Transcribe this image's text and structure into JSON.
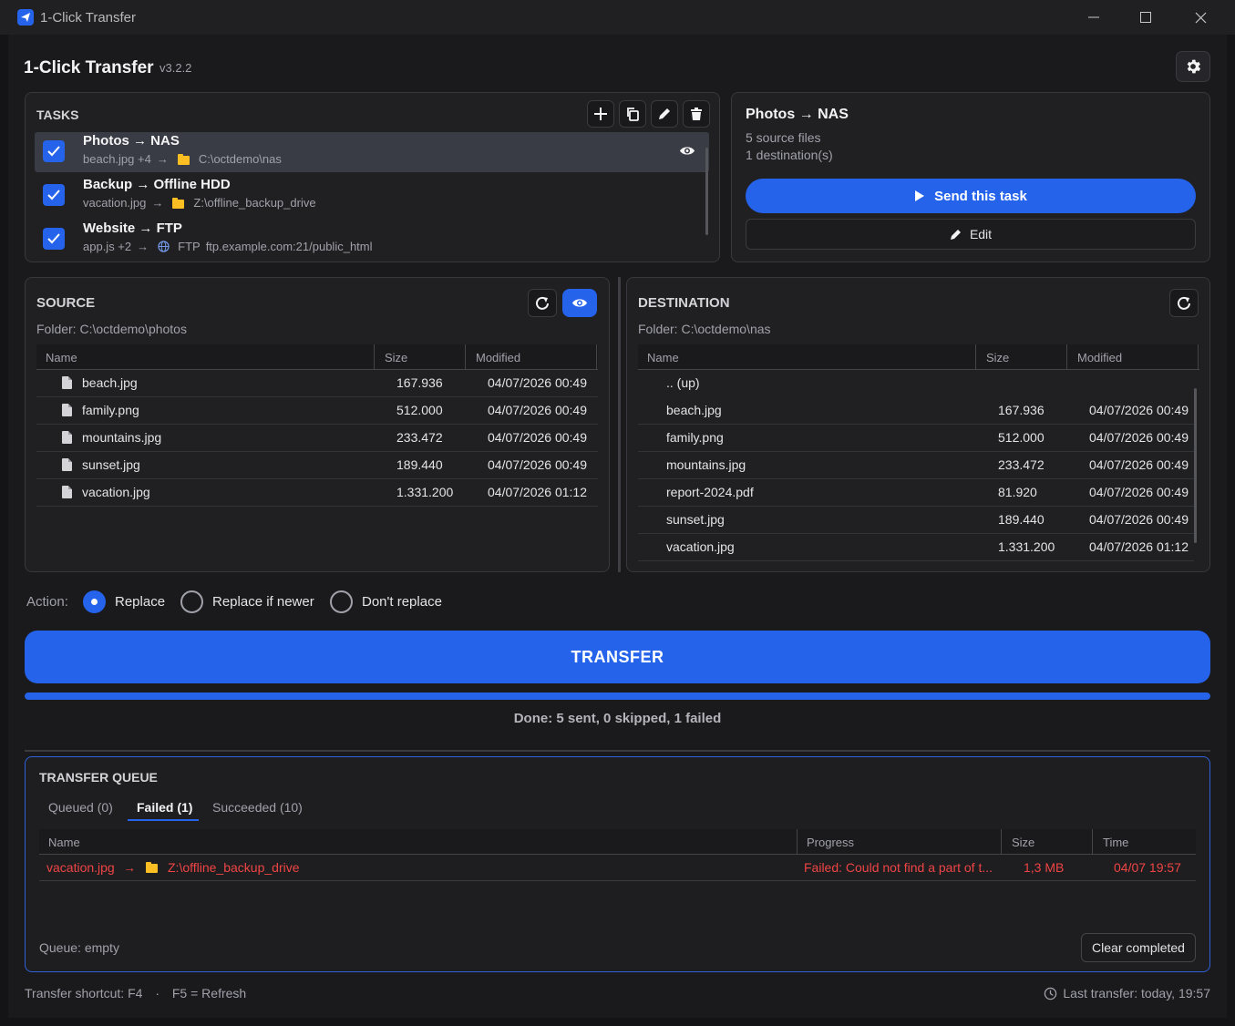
{
  "window": {
    "title": "1-Click Transfer"
  },
  "app": {
    "title": "1-Click Transfer",
    "version": "v3.2.2"
  },
  "tasks": {
    "label": "TASKS",
    "items": [
      {
        "name": "Photos → NAS",
        "files": "beach.jpg +4",
        "arrow": "→",
        "dest_type": "",
        "dest": "C:\\octdemo\\nas",
        "checked": true,
        "selected": true
      },
      {
        "name": "Backup → Offline HDD",
        "files": "vacation.jpg",
        "arrow": "→",
        "dest_type": "",
        "dest": "Z:\\offline_backup_drive",
        "checked": true,
        "selected": false
      },
      {
        "name": "Website → FTP",
        "files": "app.js +2",
        "arrow": "→",
        "dest_type": "FTP",
        "dest": "ftp.example.com:21/public_html",
        "checked": true,
        "selected": false
      }
    ]
  },
  "detail": {
    "title": "Photos → NAS",
    "source_count": "5 source files",
    "dest_count": "1 destination(s)",
    "send_label": "Send this task",
    "edit_label": "Edit"
  },
  "source": {
    "label": "SOURCE",
    "folder": "Folder: C:\\octdemo\\photos",
    "columns": [
      "Name",
      "Size",
      "Modified"
    ],
    "rows": [
      {
        "name": "beach.jpg",
        "size": "167.936",
        "modified": "04/07/2026 00:49"
      },
      {
        "name": "family.png",
        "size": "512.000",
        "modified": "04/07/2026 00:49"
      },
      {
        "name": "mountains.jpg",
        "size": "233.472",
        "modified": "04/07/2026 00:49"
      },
      {
        "name": "sunset.jpg",
        "size": "189.440",
        "modified": "04/07/2026 00:49"
      },
      {
        "name": "vacation.jpg",
        "size": "1.331.200",
        "modified": "04/07/2026 01:12"
      }
    ]
  },
  "destination": {
    "label": "DESTINATION",
    "folder": "Folder: C:\\octdemo\\nas",
    "columns": [
      "Name",
      "Size",
      "Modified"
    ],
    "up_label": "..  (up)",
    "rows": [
      {
        "name": "beach.jpg",
        "size": "167.936",
        "modified": "04/07/2026 00:49"
      },
      {
        "name": "family.png",
        "size": "512.000",
        "modified": "04/07/2026 00:49"
      },
      {
        "name": "mountains.jpg",
        "size": "233.472",
        "modified": "04/07/2026 00:49"
      },
      {
        "name": "report-2024.pdf",
        "size": "81.920",
        "modified": "04/07/2026 00:49"
      },
      {
        "name": "sunset.jpg",
        "size": "189.440",
        "modified": "04/07/2026 00:49"
      },
      {
        "name": "vacation.jpg",
        "size": "1.331.200",
        "modified": "04/07/2026 01:12"
      }
    ]
  },
  "action": {
    "label": "Action:",
    "options": [
      "Replace",
      "Replace if newer",
      "Don't replace"
    ],
    "selected": "Replace"
  },
  "transfer": {
    "button_label": "TRANSFER",
    "progress": 1.0,
    "status": "Done: 5 sent, 0 skipped, 1 failed"
  },
  "queue": {
    "label": "TRANSFER QUEUE",
    "tabs": [
      "Queued (0)",
      "Failed (1)",
      "Succeeded (10)"
    ],
    "active_tab": "Failed (1)",
    "columns": [
      "Name",
      "Progress",
      "Size",
      "Time"
    ],
    "rows": [
      {
        "name": "vacation.jpg",
        "arrow": "→",
        "dest": "Z:\\offline_backup_drive",
        "progress": "Failed: Could not find a part of t...",
        "size": "1,3 MB",
        "time": "04/07 19:57"
      }
    ],
    "status": "Queue: empty",
    "clear_label": "Clear completed"
  },
  "footer": {
    "shortcut": "Transfer shortcut: F4",
    "dot": "·",
    "refresh": "F5 = Refresh",
    "last_transfer": "Last transfer: today, 19:57"
  },
  "colors": {
    "accent": "#2563eb",
    "error": "#ef4444",
    "folder": "#fbbf24",
    "background": "#1a1a1d"
  }
}
